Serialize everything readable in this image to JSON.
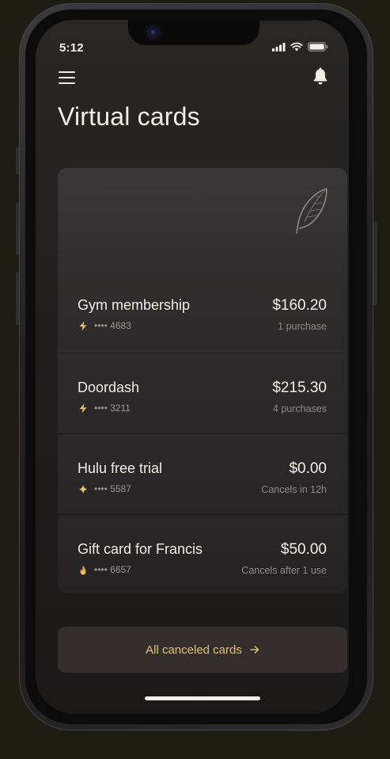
{
  "status_bar": {
    "time": "5:12",
    "signal_icon": "signal-bars-icon",
    "wifi_icon": "wifi-icon",
    "battery_icon": "battery-icon"
  },
  "header": {
    "menu_icon": "hamburger-menu-icon",
    "notification_icon": "bell-icon",
    "title": "Virtual cards"
  },
  "card_art": {
    "logo_icon": "feather-logo-icon"
  },
  "cards": [
    {
      "name": "Gym membership",
      "amount": "$160.20",
      "masked_number": "•••• 4683",
      "status": "1 purchase",
      "type_icon": "lightning-icon"
    },
    {
      "name": "Doordash",
      "amount": "$215.30",
      "masked_number": "•••• 3211",
      "status": "4 purchases",
      "type_icon": "lightning-icon"
    },
    {
      "name": "Hulu free trial",
      "amount": "$0.00",
      "masked_number": "•••• 5587",
      "status": "Cancels in 12h",
      "type_icon": "sparkle-icon"
    },
    {
      "name": "Gift card for Francis",
      "amount": "$50.00",
      "masked_number": "•••• 6657",
      "status": "Cancels after 1 use",
      "type_icon": "flame-icon"
    }
  ],
  "canceled_button": {
    "label": "All canceled cards",
    "icon": "arrow-right-icon"
  },
  "colors": {
    "background": "#1f1d13",
    "screen": "#22201f",
    "accent": "#e5c171",
    "text_primary": "#f2eee4",
    "text_secondary": "#9d9993"
  }
}
